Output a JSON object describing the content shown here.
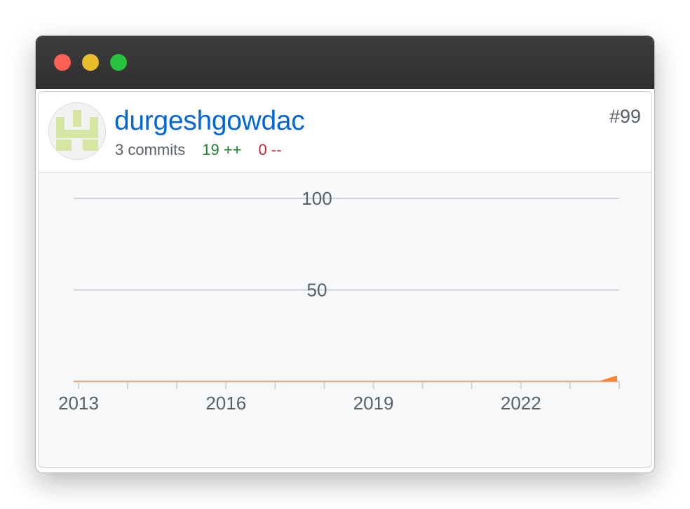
{
  "window": {
    "controls": [
      "close",
      "minimize",
      "maximize"
    ]
  },
  "contributor": {
    "username": "durgeshgowdac",
    "commits": "3 commits",
    "additions": "19 ++",
    "deletions": "0 --",
    "rank": "#99",
    "avatar_icon": "identicon-avatar",
    "colors": {
      "link": "#0366d6",
      "additions": "#28a745",
      "deletions": "#cb2431",
      "avatar": "#d6e5a2"
    }
  },
  "chart_data": {
    "type": "area",
    "x_tick_labels": [
      "2013",
      "2016",
      "2019",
      "2022"
    ],
    "y_tick_labels": [
      "100",
      "50"
    ],
    "xlim": [
      2012.9,
      2024.0
    ],
    "ylim": [
      0,
      100
    ],
    "grid": true,
    "series": [
      {
        "x": [
          2012.9,
          2023.6,
          2023.95
        ],
        "y": [
          0,
          0,
          3
        ],
        "color": "#fb8532"
      }
    ]
  }
}
